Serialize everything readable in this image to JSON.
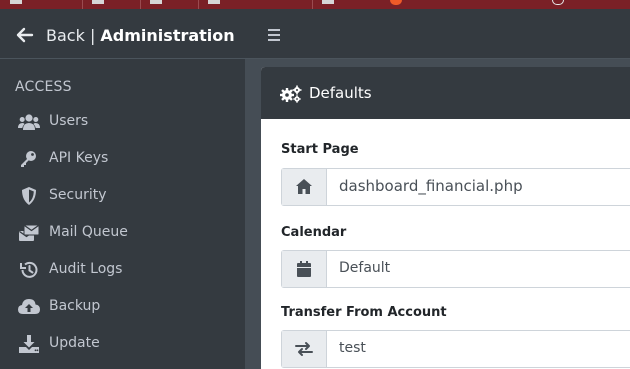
{
  "sidebar": {
    "back_label": "Back",
    "separator": "|",
    "title": "Administration",
    "section_header": "ACCESS",
    "items": [
      {
        "label": "Users",
        "icon": "users-icon"
      },
      {
        "label": "API Keys",
        "icon": "key-icon"
      },
      {
        "label": "Security",
        "icon": "shield-icon"
      },
      {
        "label": "Mail Queue",
        "icon": "mail-queue-icon"
      },
      {
        "label": "Audit Logs",
        "icon": "history-icon"
      },
      {
        "label": "Backup",
        "icon": "cloud-upload-icon"
      },
      {
        "label": "Update",
        "icon": "download-icon"
      }
    ]
  },
  "card": {
    "title": "Defaults",
    "fields": [
      {
        "label": "Start Page",
        "value": "dashboard_financial.php",
        "icon": "home-icon"
      },
      {
        "label": "Calendar",
        "value": "Default",
        "icon": "calendar-icon"
      },
      {
        "label": "Transfer From Account",
        "value": "test",
        "icon": "exchange-icon"
      }
    ]
  },
  "colors": {
    "sidebar_bg": "#343a40",
    "content_bg": "#454d55",
    "card_bg": "#ffffff",
    "browser_bar": "#7a2026"
  }
}
